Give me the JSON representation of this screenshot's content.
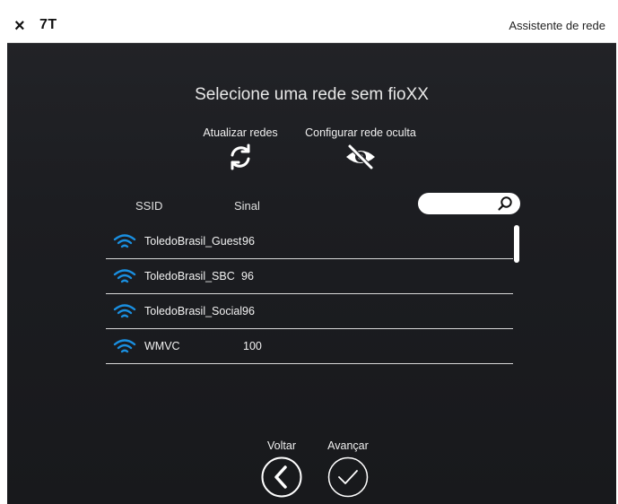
{
  "titlebar": {
    "close_glyph": "×",
    "app_code": "7T",
    "title": "Assistente de rede"
  },
  "heading": "Selecione uma rede sem fioXX",
  "actions": {
    "refresh_label": "Atualizar redes",
    "refresh_icon": "refresh-icon",
    "hidden_label": "Configurar rede oculta",
    "hidden_icon": "eye-slash-icon"
  },
  "columns": {
    "ssid": "SSID",
    "signal": "Sinal"
  },
  "search": {
    "value": "",
    "placeholder": "",
    "icon": "search-icon"
  },
  "networks": [
    {
      "ssid": "ToledoBrasil_Guest",
      "signal": "96",
      "icon": "wifi-icon"
    },
    {
      "ssid": "ToledoBrasil_SBC",
      "signal": "96",
      "icon": "wifi-icon"
    },
    {
      "ssid": "ToledoBrasil_Social",
      "signal": "96",
      "icon": "wifi-icon"
    },
    {
      "ssid": "WMVC",
      "signal": "100",
      "icon": "wifi-icon"
    }
  ],
  "nav": {
    "back_label": "Voltar",
    "next_label": "Avançar"
  },
  "colors": {
    "background": "#1f2024",
    "wifi": "#1a8fe0",
    "text": "#f0f0f0"
  }
}
